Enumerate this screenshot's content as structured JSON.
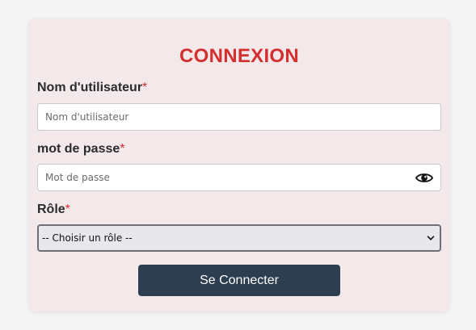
{
  "form": {
    "title": "CONNEXION",
    "username": {
      "label": "Nom d'utilisateur",
      "required_mark": "*",
      "placeholder": "Nom d'utilisateur",
      "value": ""
    },
    "password": {
      "label": "mot de passe",
      "required_mark": "*",
      "placeholder": "Mot de passe",
      "value": "",
      "toggle_icon": "eye-icon"
    },
    "role": {
      "label": "Rôle",
      "required_mark": "*",
      "selected": "-- Choisir un rôle --",
      "arrow_icon": "chevron-down-icon"
    },
    "submit_label": "Se Connecter"
  },
  "colors": {
    "accent_red": "#d32f2f",
    "button_bg": "#2c3e50",
    "card_bg": "#f4e9ea",
    "page_bg": "#f4f4f4"
  }
}
